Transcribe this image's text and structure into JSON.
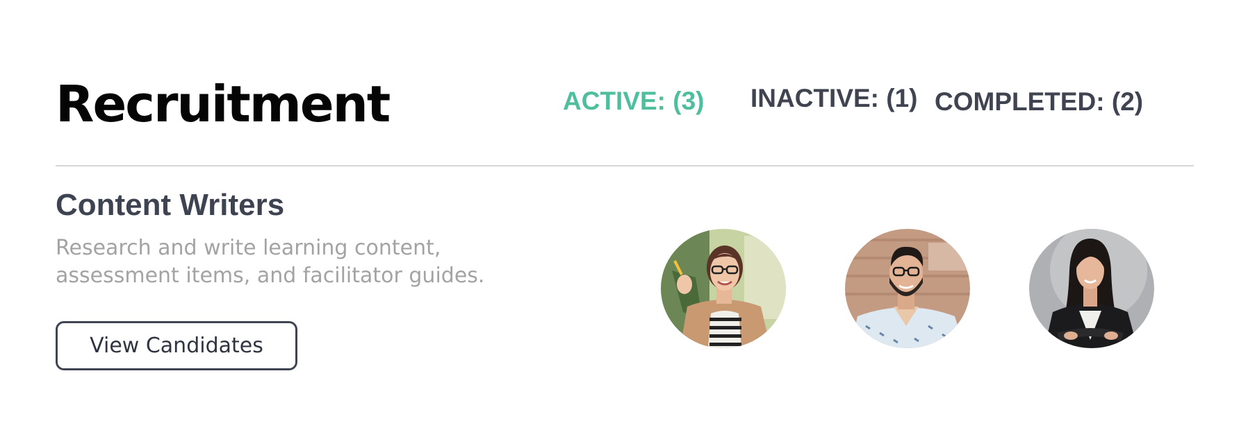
{
  "header": {
    "title": "Recruitment",
    "tabs": [
      {
        "label": "ACTIVE: (3)",
        "state": "active"
      },
      {
        "label": "INACTIVE: (1)",
        "state": "inactive"
      },
      {
        "label": "COMPLETED: (2)",
        "state": "inactive"
      }
    ]
  },
  "job": {
    "title": "Content Writers",
    "description": "Research and write learning content, assessment items, and facilitator guides.",
    "button_label": "View Candidates",
    "candidates": [
      {
        "avatar": "woman-with-glasses-photo"
      },
      {
        "avatar": "man-with-beard-photo"
      },
      {
        "avatar": "woman-in-blazer-photo"
      }
    ]
  },
  "colors": {
    "accent": "#4fbe9c",
    "tab_text": "#3f4450",
    "title_text": "#050505",
    "description_text": "#a3a3a3",
    "button_border": "#3e4452",
    "divider": "#d6d6d6"
  }
}
